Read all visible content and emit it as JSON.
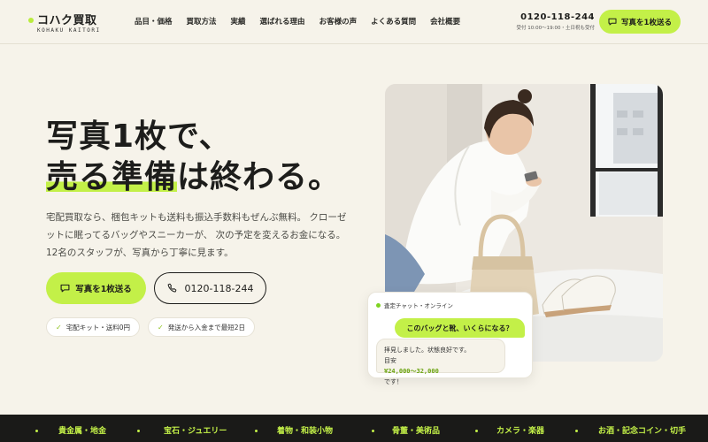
{
  "header": {
    "logo_text": "コハク買取",
    "logo_sub": "KOHAKU KAITORI",
    "nav": [
      "品目・価格",
      "買取方法",
      "実績",
      "選ばれる理由",
      "お客様の声",
      "よくある質問",
      "会社概要"
    ],
    "phone": "0120-118-244",
    "hours": "受付 10:00〜19:00・土日祝も受付",
    "cta_label": "写真を1枚送る"
  },
  "hero": {
    "title_line1": "写真1枚で、",
    "title_line2_highlight": "売る準備",
    "title_line2_rest": "は終わる。",
    "desc_lines": [
      "宅配買取なら、梱包キットも送料も振込手数料もぜんぶ無料。 クローゼ",
      "ットに眠ってるバッグやスニーカーが、 次の予定を変えるお金になる。",
      "12名のスタッフが、写真から丁寧に見ます。"
    ],
    "primary_label": "写真を1枚送る",
    "phone_label": "0120-118-244",
    "badges": [
      "宅配キット・送料0円",
      "発送から入金まで最短2日"
    ]
  },
  "chat": {
    "status": "査定チャット・オンライン",
    "user_message": "このバッグと靴、いくらになる？",
    "reply_line1": "拝見しました。状態良好です。",
    "reply_prefix": "目安 ",
    "reply_price": "¥24,000〜32,000",
    "reply_suffix": " です！"
  },
  "categories": [
    "貴金属・地金",
    "宝石・ジュエリー",
    "着物・和装小物",
    "骨董・美術品",
    "カメラ・楽器",
    "お酒・記念コイン・切手"
  ],
  "colors": {
    "accent": "#c3f048",
    "background": "#f6f3ea",
    "band": "#1a1a18",
    "text": "#1d1d1b"
  },
  "icons": {
    "cta": "chat-icon",
    "phone": "phone-icon",
    "badge": "check-icon"
  }
}
